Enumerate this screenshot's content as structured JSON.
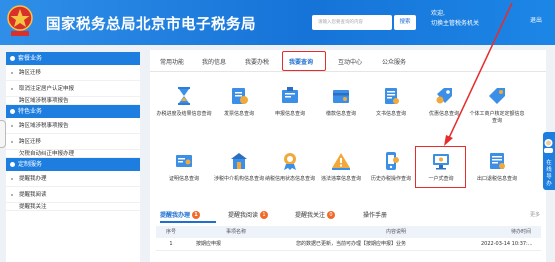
{
  "header": {
    "title": "国家税务总局北京市电子税务局",
    "search_placeholder": "请输入您要查询的内容",
    "search_label": "搜索",
    "welcome_line1": "欢迎,",
    "welcome_line2": "切换主管税务机关",
    "logout_label": "退出",
    "colors": {
      "brand": "#1673d8",
      "highlight": "#e62c2c"
    }
  },
  "sidebar": {
    "sections": [
      {
        "title": "套餐业务",
        "items": [
          "跨区迁移",
          "取消注定居户认定申报",
          "跨区域涉税事项报告"
        ]
      },
      {
        "title": "特色业务",
        "items": [
          "跨区域涉税事项报告",
          "跨区迁移",
          "欠税自动纠正申报办理"
        ]
      },
      {
        "title": "定制服务",
        "items": [
          "提醒我办理",
          "提醒我阅读",
          "提醒我关注"
        ]
      }
    ]
  },
  "main": {
    "tabs": [
      {
        "label": "常用功能"
      },
      {
        "label": "我的信息"
      },
      {
        "label": "我要办税"
      },
      {
        "label": "我要查询"
      },
      {
        "label": "互动中心"
      },
      {
        "label": "公众服务"
      }
    ],
    "active_tab": "我要查询",
    "services": [
      {
        "label": "办税进度及结果信息查询",
        "icon": "hourglass-icon"
      },
      {
        "label": "发票信息查询",
        "icon": "invoice-icon"
      },
      {
        "label": "申报信息查询",
        "icon": "tax-return-icon"
      },
      {
        "label": "缴款信息查询",
        "icon": "payment-icon"
      },
      {
        "label": "文书信息查询",
        "icon": "document-icon"
      },
      {
        "label": "优惠信息查询",
        "icon": "discount-icon"
      },
      {
        "label": "个体工商户核定定额信息查询",
        "icon": "tag-icon"
      },
      {
        "label": "证明信息查询",
        "icon": "certificate-icon"
      },
      {
        "label": "涉税中介机构信息查询",
        "icon": "agency-icon"
      },
      {
        "label": "纳税信用状态信息查询",
        "icon": "credit-icon"
      },
      {
        "label": "违法违章信息查询",
        "icon": "warning-icon"
      },
      {
        "label": "历史办税操作查询",
        "icon": "history-icon"
      },
      {
        "label": "一户式查询",
        "icon": "monitor-icon"
      },
      {
        "label": "出口退税信息查询",
        "icon": "export-refund-icon"
      }
    ],
    "sub_tabs": [
      {
        "label": "提醒我办理",
        "count": "1"
      },
      {
        "label": "提醒我阅读",
        "count": "1"
      },
      {
        "label": "提醒我关注",
        "count": "0"
      },
      {
        "label": "操作手册",
        "count": ""
      }
    ],
    "more_label": "更多",
    "table": {
      "headers": [
        "序号",
        "事项名称",
        "内容说明",
        "待办时间"
      ],
      "rows": [
        {
          "index": "1",
          "name": "按期应申报",
          "description": "您的数据已更新，当前可办理【按期应申报】业务",
          "time": "2022-03-14 10:37:..."
        }
      ]
    }
  },
  "floating_widget": {
    "label": "在线导办"
  }
}
